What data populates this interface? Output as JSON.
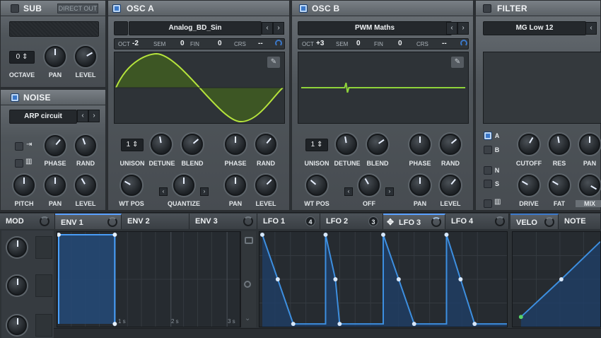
{
  "sub": {
    "title": "SUB",
    "direct_out": "DIRECT OUT",
    "octave_label": "OCTAVE",
    "octave_value": "0",
    "pan_label": "PAN",
    "level_label": "LEVEL"
  },
  "noise": {
    "title": "NOISE",
    "preset": "ARP circuit",
    "phase_label": "PHASE",
    "rand_label": "RAND",
    "pitch_label": "PITCH",
    "pan_label": "PAN",
    "level_label": "LEVEL"
  },
  "osc_a": {
    "title": "OSC A",
    "wavetable": "Analog_BD_Sin",
    "oct_label": "OCT",
    "oct_value": "-2",
    "sem_label": "SEM",
    "sem_value": "0",
    "fin_label": "FIN",
    "fin_value": "0",
    "crs_label": "CRS",
    "crs_value": "--",
    "unison_value": "1",
    "unison_label": "UNISON",
    "detune_label": "DETUNE",
    "blend_label": "BLEND",
    "phase_label": "PHASE",
    "rand_label": "RAND",
    "wtpos_label": "WT POS",
    "quantize_label": "QUANTIZE",
    "pan_label": "PAN",
    "level_label": "LEVEL"
  },
  "osc_b": {
    "title": "OSC B",
    "wavetable": "PWM Maths",
    "oct_label": "OCT",
    "oct_value": "+3",
    "sem_label": "SEM",
    "sem_value": "0",
    "fin_label": "FIN",
    "fin_value": "0",
    "crs_label": "CRS",
    "crs_value": "--",
    "unison_value": "1",
    "unison_label": "UNISON",
    "detune_label": "DETUNE",
    "blend_label": "BLEND",
    "phase_label": "PHASE",
    "rand_label": "RAND",
    "wtpos_label": "WT POS",
    "off_label": "OFF",
    "pan_label": "PAN",
    "level_label": "LEVEL"
  },
  "filter": {
    "title": "FILTER",
    "type": "MG Low 12",
    "route_a": "A",
    "route_b": "B",
    "route_n": "N",
    "route_s": "S",
    "cutoff_label": "CUTOFF",
    "res_label": "RES",
    "pan_label": "PAN",
    "drive_label": "DRIVE",
    "fat_label": "FAT",
    "mix_label": "MIX"
  },
  "mod": {
    "title": "MOD"
  },
  "env_tabs": [
    "ENV 1",
    "ENV 2",
    "ENV 3"
  ],
  "lfo_tabs": [
    {
      "label": "LFO 1",
      "count": "4"
    },
    {
      "label": "LFO 2",
      "count": "3"
    },
    {
      "label": "LFO 3",
      "count": ""
    },
    {
      "label": "LFO 4",
      "count": ""
    }
  ],
  "right_tabs": [
    "VELO",
    "NOTE"
  ],
  "env_graph": {
    "marks": [
      "1 s",
      "2 s",
      "3 s"
    ]
  },
  "colors": {
    "accent": "#3b78c9",
    "wave_green": "#a6d93a",
    "lfo_blue": "#3d8fe0"
  }
}
